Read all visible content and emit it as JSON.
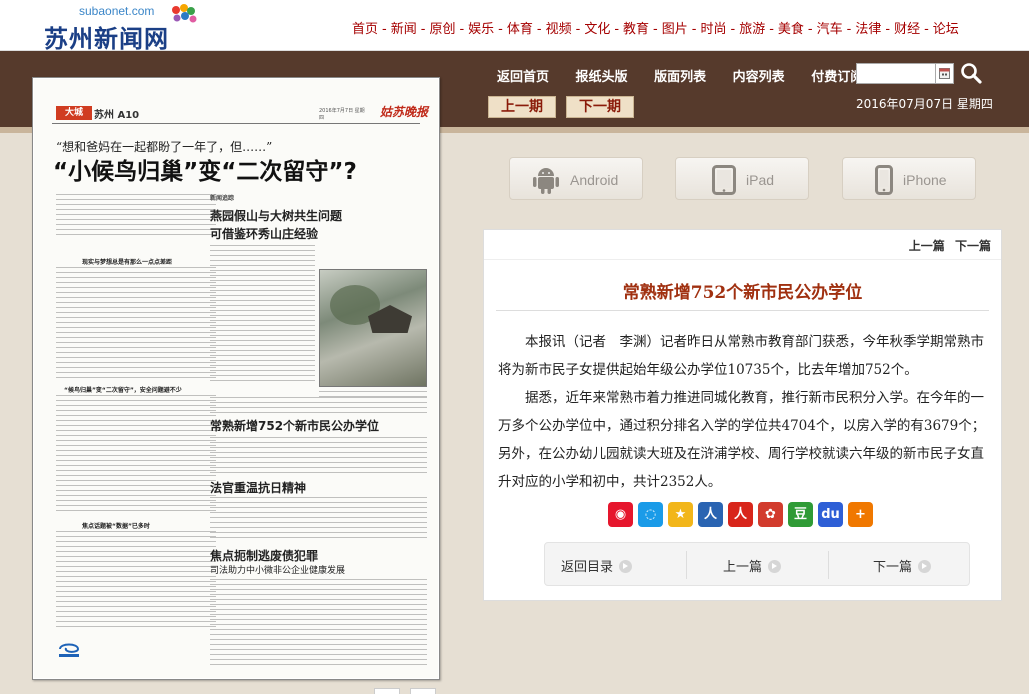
{
  "header": {
    "logo_domain": "subaonet.com",
    "logo_name": "苏州新闻网",
    "nav": [
      "首页",
      "新闻",
      "原创",
      "娱乐",
      "体育",
      "视频",
      "文化",
      "教育",
      "图片",
      "时尚",
      "旅游",
      "美食",
      "汽车",
      "法律",
      "财经",
      "论坛"
    ],
    "nav_color": "#a50000"
  },
  "menu": {
    "items": [
      "返回首页",
      "报纸头版",
      "版面列表",
      "内容列表",
      "付费订阅"
    ],
    "search_placeholder": "",
    "prev_issue": "上一期",
    "next_issue": "下一期",
    "date": "2016年07月07日  星期四"
  },
  "newspaper": {
    "section_tag": "大城",
    "section_page": "苏州 A10",
    "issue_date": "2016年7月7日 星期四",
    "brand": "姑苏晚报",
    "kicker": "“想和爸妈在一起都盼了一年了，但……”",
    "headline": "“小候鸟归巢”变“二次留守”?",
    "sub1": "燕园假山与大树共生问题",
    "sub1b": "可借鉴环秀山庄经验",
    "sub2": "常熟新增752个新市民公办学位",
    "sub3": "法官重温抗日精神",
    "sub4": "焦点扼制逃废债犯罪",
    "sub4b": "司法助力中小微非公企业健康发展",
    "side_label": "新闻追踪",
    "box1": "现实与梦想总是有那么一点点差距",
    "box2": "“候鸟归巢”变“二次留守”，安全问题避不少",
    "box3": "焦点话题被“数据”已多时"
  },
  "apps": [
    {
      "label": "Android",
      "icon": "android-icon"
    },
    {
      "label": "iPad",
      "icon": "tablet-icon"
    },
    {
      "label": "iPhone",
      "icon": "phone-icon"
    }
  ],
  "article": {
    "prev": "上一篇",
    "next": "下一篇",
    "title": "常熟新增752个新市民公办学位",
    "paragraphs": [
      "本报讯（记者　李渊）记者昨日从常熟市教育部门获悉，今年秋季学期常熟市将为新市民子女提供起始年级公办学位10735个，比去年增加752个。",
      "据悉，近年来常熟市着力推进同城化教育，推行新市民积分入学。在今年的一万多个公办学位中，通过积分排名入学的学位共4704个，以房入学的有3679个；另外，在公办幼儿园就读大班及在浒浦学校、周行学校就读六年级的新市民子女直升对应的小学和初中，共计2352人。"
    ],
    "share": [
      {
        "name": "weibo-share-icon",
        "glyph": "◉",
        "color": "#e6162d"
      },
      {
        "name": "tencent-share-icon",
        "glyph": "◌",
        "color": "#1a9be8"
      },
      {
        "name": "qzone-share-icon",
        "glyph": "★",
        "color": "#f2b61a"
      },
      {
        "name": "renren-share-icon",
        "glyph": "人",
        "color": "#2a64b2"
      },
      {
        "name": "people-share-icon",
        "glyph": "人",
        "color": "#d8261b"
      },
      {
        "name": "kaixin-share-icon",
        "glyph": "✿",
        "color": "#d23b2d"
      },
      {
        "name": "douban-share-icon",
        "glyph": "豆",
        "color": "#2f9b36"
      },
      {
        "name": "baidu-share-icon",
        "glyph": "du",
        "color": "#2e5fd6"
      },
      {
        "name": "more-share-icon",
        "glyph": "+",
        "color": "#f07800"
      }
    ],
    "back_to_list": "返回目录",
    "bottom_prev": "上一篇",
    "bottom_next": "下一篇"
  }
}
